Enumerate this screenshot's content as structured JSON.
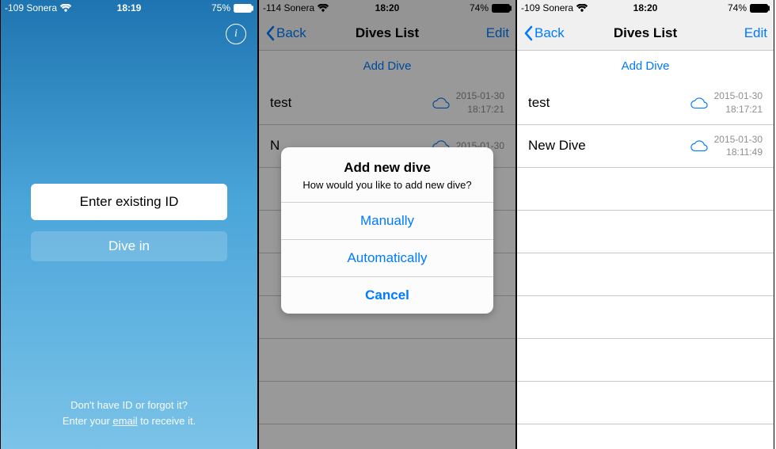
{
  "screen1": {
    "status": {
      "carrier": "-109 Sonera",
      "time": "18:19",
      "battery": "75%"
    },
    "info_glyph": "i",
    "enter_id_label": "Enter existing ID",
    "dive_in_label": "Dive in",
    "footer_line1": "Don't have ID or forgot it?",
    "footer_prefix": "Enter your ",
    "footer_email": "email",
    "footer_suffix": " to receive it."
  },
  "screen2": {
    "status": {
      "carrier": "-114 Sonera",
      "time": "18:20",
      "battery": "74%"
    },
    "nav": {
      "back": "Back",
      "title": "Dives List",
      "edit": "Edit"
    },
    "add_dive": "Add Dive",
    "rows": [
      {
        "title": "test",
        "date": "2015-01-30",
        "time": "18:17:21"
      },
      {
        "title": "N",
        "date": "2015-01-30",
        "time": ""
      }
    ],
    "modal": {
      "title": "Add new dive",
      "message": "How would you like to add new dive?",
      "manually": "Manually",
      "automatically": "Automatically",
      "cancel": "Cancel"
    }
  },
  "screen3": {
    "status": {
      "carrier": "-109 Sonera",
      "time": "18:20",
      "battery": "74%"
    },
    "nav": {
      "back": "Back",
      "title": "Dives List",
      "edit": "Edit"
    },
    "add_dive": "Add Dive",
    "rows": [
      {
        "title": "test",
        "date": "2015-01-30",
        "time": "18:17:21"
      },
      {
        "title": "New Dive",
        "date": "2015-01-30",
        "time": "18:11:49"
      }
    ]
  }
}
